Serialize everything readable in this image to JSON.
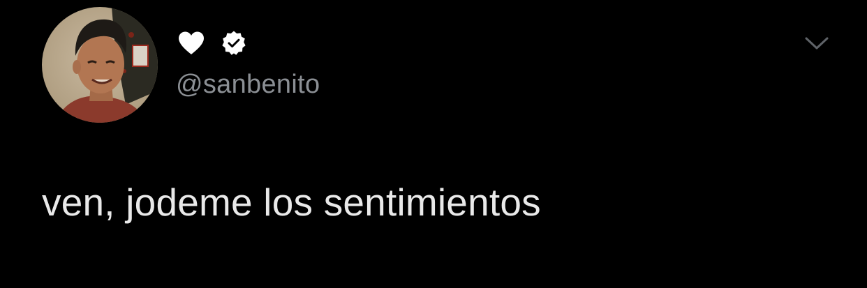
{
  "tweet": {
    "display_name_icon": "white-heart-icon",
    "verified_badge_icon": "verified-badge-icon",
    "handle": "@sanbenito",
    "text": "ven, jodeme los sentimientos",
    "menu_icon": "chevron-down-icon",
    "avatar_description_icon": "profile-avatar"
  },
  "colors": {
    "background": "#000000",
    "text": "#e9e9e9",
    "handle": "#8b8f94",
    "caret": "#5f6368",
    "heart": "#ffffff"
  }
}
